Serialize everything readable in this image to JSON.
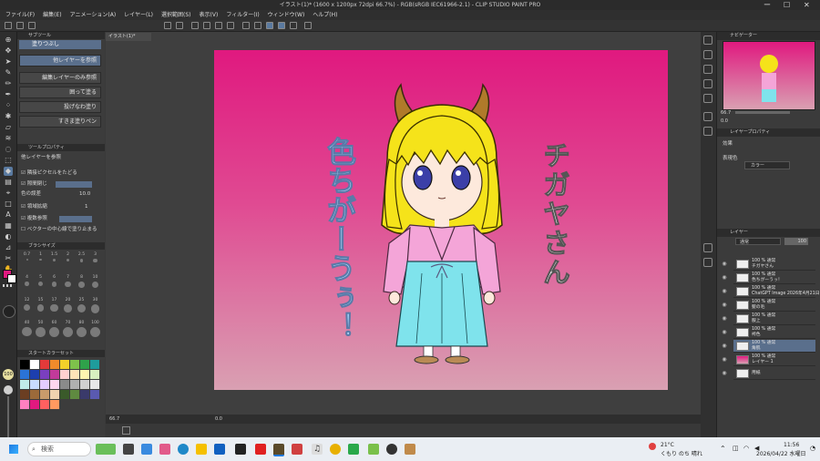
{
  "window": {
    "title": "イラスト(1)* (1600 x 1200px 72dpi 66.7%) - RGB(sRGB IEC61966-2.1) - CLIP STUDIO PAINT PRO",
    "controls": [
      "ー",
      "☐",
      "✕"
    ]
  },
  "menu": [
    "ファイル(F)",
    "編集(E)",
    "アニメーション(A)",
    "レイヤー(L)",
    "選択範囲(S)",
    "表示(V)",
    "フィルター(I)",
    "ウィンドウ(W)",
    "ヘルプ(H)"
  ],
  "doc_tab": "イラスト(1)*",
  "tool_panel": {
    "header": "サブツール",
    "active_tool": "塗りつぶし",
    "subtools": [
      "他レイヤーを参照",
      "編集レイヤーのみ参照",
      "囲って塗る",
      "投げなわ塗り",
      "すきま塗りペン"
    ]
  },
  "tool_property": {
    "header": "ツールプロパティ",
    "title": "他レイヤーを参照",
    "rows": [
      {
        "label": "隣接ピクセルをたどる",
        "value": ""
      },
      {
        "label": "隙間閉じ",
        "value": ""
      },
      {
        "label": "色の誤差",
        "value": "10.0"
      },
      {
        "label": "領域拡縮",
        "value": "1"
      },
      {
        "label": "複数参照",
        "value": ""
      },
      {
        "label": "ベクターの中心線で塗り止まる",
        "value": ""
      }
    ]
  },
  "brush_size": {
    "header": "ブラシサイズ",
    "sizes": [
      "0.7",
      "1",
      "1.5",
      "2",
      "2.5",
      "3",
      "4",
      "5",
      "6",
      "7",
      "8",
      "10",
      "12",
      "15",
      "17",
      "20",
      "25",
      "30",
      "40",
      "50",
      "60",
      "70",
      "80",
      "100"
    ]
  },
  "color_set": {
    "header": "スタートカラーセット",
    "colors": [
      "#000000",
      "#ffffff",
      "#e23a3a",
      "#f08a2b",
      "#f2d12a",
      "#7ec24b",
      "#2fa24a",
      "#1f9c9c",
      "#2b73d6",
      "#1d3fae",
      "#7a3fbf",
      "#c23a9a",
      "#ffd0d0",
      "#ffe3b8",
      "#fff4b0",
      "#d8f0c0",
      "#c0ece8",
      "#c8dcff",
      "#e3ccff",
      "#ffd6ee",
      "#8a8a8a",
      "#b0b0b0",
      "#d0d0d0",
      "#e8e8e8",
      "#6b3e22",
      "#9c6a3a",
      "#c99b6b",
      "#f0d2b0",
      "#3a5a2a",
      "#5f8a40",
      "#3a3a6a",
      "#5a5ab0",
      "#ff80c0",
      "#e0197f",
      "#ff6060",
      "#ff9a60"
    ],
    "main_color": "#e0197f"
  },
  "artwork": {
    "text_right": "チガヤさん",
    "text_left": "色ちがーうぅ！",
    "gradient_top": "#e0197f",
    "gradient_bottom": "#d9a0b2"
  },
  "canvas_status": {
    "zoom": "66.7",
    "angle": "0.0"
  },
  "navigator": {
    "header": "ナビゲーター",
    "zoom": "66.7",
    "angle": "0.0"
  },
  "layer_property": {
    "header": "レイヤープロパティ",
    "effect_label": "効果",
    "expression_label": "表現色",
    "expression_value": "カラー"
  },
  "layers": {
    "header": "レイヤー",
    "blend": "通常",
    "opacity": "100",
    "items": [
      {
        "top": "100 % 通常",
        "name": "チガヤさん",
        "selected": false
      },
      {
        "top": "100 % 通常",
        "name": "色ちがーうぅ！",
        "selected": false
      },
      {
        "top": "100 % 通常",
        "name": "ChatGPT Image 2026年4月21日",
        "selected": false
      },
      {
        "top": "100 % 通常",
        "name": "髪の毛",
        "selected": false
      },
      {
        "top": "100 % 通常",
        "name": "服上",
        "selected": false
      },
      {
        "top": "100 % 通常",
        "name": "袴色",
        "selected": false
      },
      {
        "top": "100 % 通常",
        "name": "角肌",
        "selected": true
      },
      {
        "top": "100 % 通常",
        "name": "レイヤー 1",
        "selected": false
      },
      {
        "top": "",
        "name": "用紙",
        "selected": false
      }
    ]
  },
  "taskbar": {
    "search_placeholder": "検索",
    "weather_temp": "21°C",
    "weather_text": "くもり のち 晴れ",
    "time": "11:56",
    "date": "2026/04/22 水曜日"
  }
}
